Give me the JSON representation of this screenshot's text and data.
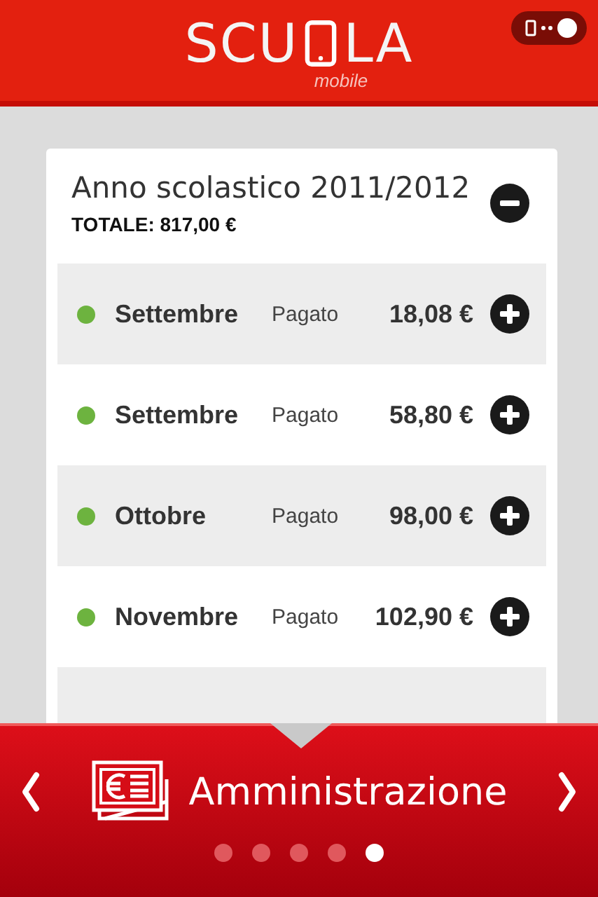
{
  "header": {
    "logo_left": "SCU",
    "logo_right": "LA",
    "logo_sub": "mobile"
  },
  "year": {
    "title": "Anno scolastico 2011/2012",
    "total": "TOTALE: 817,00 €",
    "expanded": true
  },
  "payments": [
    {
      "month": "Settembre",
      "status": "Pagato",
      "amount": "18,08 €",
      "color": "#6db33f"
    },
    {
      "month": "Settembre",
      "status": "Pagato",
      "amount": "58,80 €",
      "color": "#6db33f"
    },
    {
      "month": "Ottobre",
      "status": "Pagato",
      "amount": "98,00 €",
      "color": "#6db33f"
    },
    {
      "month": "Novembre",
      "status": "Pagato",
      "amount": "102,90 €",
      "color": "#6db33f"
    }
  ],
  "section": {
    "title": "Amministrazione"
  },
  "pages": [
    {
      "selected": false
    },
    {
      "selected": false
    },
    {
      "selected": false
    },
    {
      "selected": false
    },
    {
      "selected": true
    }
  ]
}
